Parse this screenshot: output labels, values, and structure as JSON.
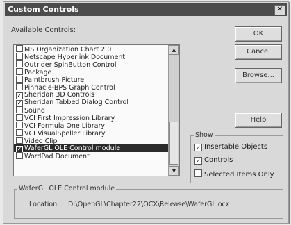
{
  "window": {
    "title": "Custom Controls",
    "close_glyph": "✕"
  },
  "available": {
    "label": "Available Controls:"
  },
  "list": {
    "items": [
      {
        "label": "MS Organization Chart 2.0",
        "checked": false,
        "selected": false
      },
      {
        "label": "Netscape Hyperlink Document",
        "checked": false,
        "selected": false
      },
      {
        "label": "Outrider SpinButton Control",
        "checked": false,
        "selected": false
      },
      {
        "label": "Package",
        "checked": false,
        "selected": false
      },
      {
        "label": "Paintbrush Picture",
        "checked": false,
        "selected": false
      },
      {
        "label": "Pinnacle-BPS Graph Control",
        "checked": false,
        "selected": false
      },
      {
        "label": "Sheridan 3D Controls",
        "checked": true,
        "selected": false
      },
      {
        "label": "Sheridan Tabbed Dialog Control",
        "checked": true,
        "selected": false
      },
      {
        "label": "Sound",
        "checked": false,
        "selected": false
      },
      {
        "label": "VCI First Impression Library",
        "checked": false,
        "selected": false
      },
      {
        "label": "VCI Formula One Library",
        "checked": false,
        "selected": false
      },
      {
        "label": "VCI VisualSpeller Library",
        "checked": false,
        "selected": false
      },
      {
        "label": "Video Clip",
        "checked": false,
        "selected": false
      },
      {
        "label": "WaferGL OLE Control module",
        "checked": true,
        "selected": true
      },
      {
        "label": "WordPad Document",
        "checked": false,
        "selected": false
      }
    ]
  },
  "buttons": {
    "ok": "OK",
    "cancel": "Cancel",
    "browse": "Browse...",
    "help": "Help"
  },
  "show": {
    "title": "Show",
    "insertable": {
      "label": "Insertable Objects",
      "checked": true
    },
    "controls": {
      "label": "Controls",
      "checked": true
    },
    "selected_only": {
      "label": "Selected Items Only",
      "checked": false
    }
  },
  "details": {
    "title": "WaferGL OLE Control module",
    "location_label": "Location:",
    "location_value": "D:\\OpenGL\\Chapter22\\OCX\\Release\\WaferGL.ocx"
  }
}
